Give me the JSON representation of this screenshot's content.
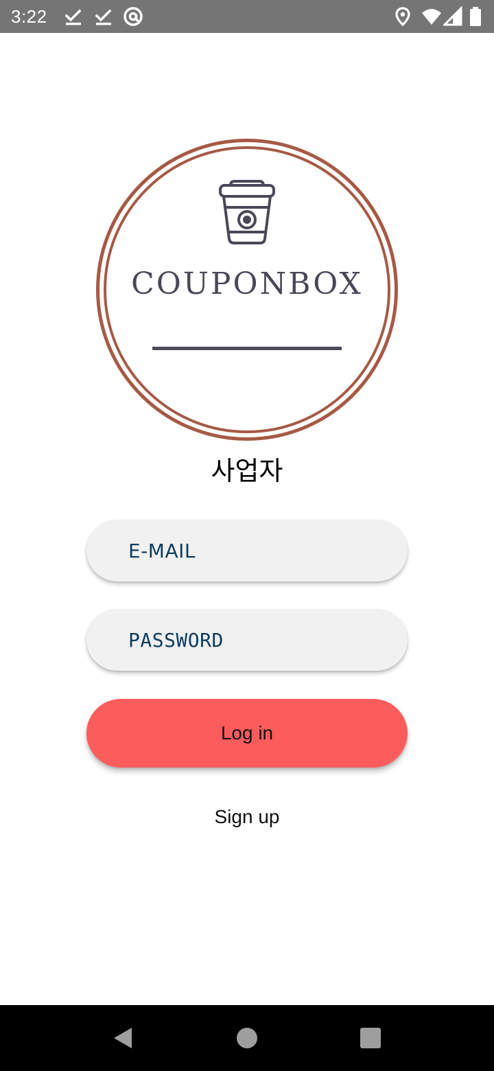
{
  "status_bar": {
    "time": "3:22",
    "left_icons": [
      "check-download-icon",
      "check-download-icon",
      "at-sign-icon"
    ],
    "right_icons": [
      "location-icon",
      "wifi-icon",
      "cell-signal-icon",
      "battery-icon"
    ]
  },
  "logo": {
    "wordmark": "COUPONBOX",
    "icon": "coffee-cup-icon",
    "ring_color": "#a65a45",
    "mark_color": "#4a4757"
  },
  "role_label": "사업자",
  "form": {
    "email_placeholder": "E-MAIL",
    "password_placeholder": "PASSWORD",
    "login_label": "Log in",
    "signup_label": "Sign up"
  },
  "colors": {
    "login_button": "#fd5c5c",
    "field_background": "#f1f1f1",
    "field_text": "#0d3c5e"
  },
  "nav_bar": {
    "buttons": [
      "back-icon",
      "home-icon",
      "recents-icon"
    ]
  }
}
